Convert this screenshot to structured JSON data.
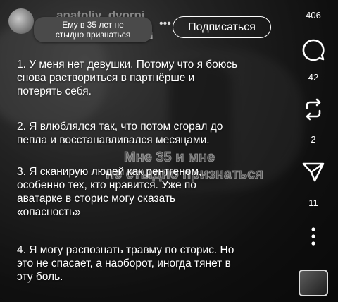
{
  "header": {
    "username": "anatoliy_dvorni",
    "username_suffix": "пі",
    "tooltip": "Ему в 35 лет не\nстыдно признаться",
    "menu": "•••",
    "subscribe_label": "Подписаться"
  },
  "post": {
    "paragraphs": [
      "1. У меня нет девушки. Потому что я боюсь\nснова раствориться в партнёрше и\nпотерять себя.",
      "2. Я влюблялся так, что потом сгорал до\nпепла и восстанавливался месяцами.",
      "3. Я сканирую людей как рентгеном,\nособенно тех, кто нравится. Уже по\nаватарке в сторис могу сказать\n«опасность»",
      "4. Я могу распознать травму по сторис. Но\nэто не спасает, а наоборот, иногда тянет в\nэту боль."
    ],
    "overlay_line1": "Мне 35 и мне",
    "overlay_line2": "не стыдно признаться"
  },
  "rail": {
    "likes": "406",
    "comments": "42",
    "reposts": "2",
    "shares": "11",
    "icons": [
      "comment-icon",
      "repost-icon",
      "share-icon",
      "more-icon",
      "audio-thumbnail"
    ]
  },
  "colors": {
    "background": "#1b1b1b",
    "text": "#ffffff",
    "tooltip": "#4a4a4a"
  }
}
